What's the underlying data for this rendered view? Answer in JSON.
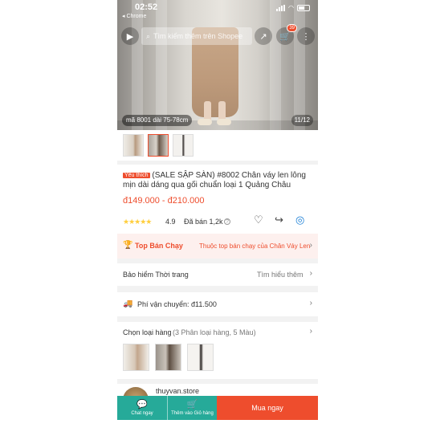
{
  "status_bar": {
    "time": "02:52",
    "back_app": "◂ Chrome"
  },
  "header": {
    "search_placeholder": "Tìm kiếm thêm trên Shopee",
    "cart_badge": "39"
  },
  "gallery": {
    "caption": "mã 8001 dài 75-78cm",
    "counter": "11/12"
  },
  "product": {
    "tag": "Yêu thích",
    "title": "(SALE SẬP SÀN) #8002 Chân váy len lông mịn dài dáng qua gối chuẩn loại 1 Quảng Châu",
    "price": "đ149.000 - đ210.000",
    "stars": "★★★★★",
    "rating": "4.9",
    "sold": "Đã bán 1,2k"
  },
  "top_sale": {
    "label": "Top Bán Chạy",
    "link": "Thuộc top bán chạy của Chân Váy Len"
  },
  "insurance": {
    "label": "Bảo hiểm Thời trang",
    "action": "Tìm hiểu thêm"
  },
  "shipping": {
    "label": "Phí vận chuyển: đ11.500"
  },
  "variants": {
    "label": "Chọn loại hàng",
    "detail": "(3 Phân loại hàng, 5 Màu)"
  },
  "shop": {
    "name": "thuyvan.store"
  },
  "bottom_bar": {
    "chat_label": "Chat ngay",
    "cart_label": "Thêm vào Giỏ hàng",
    "buy_label": "Mua ngay"
  },
  "colors": {
    "accent": "#ee4d2d",
    "teal": "#26aa99"
  }
}
